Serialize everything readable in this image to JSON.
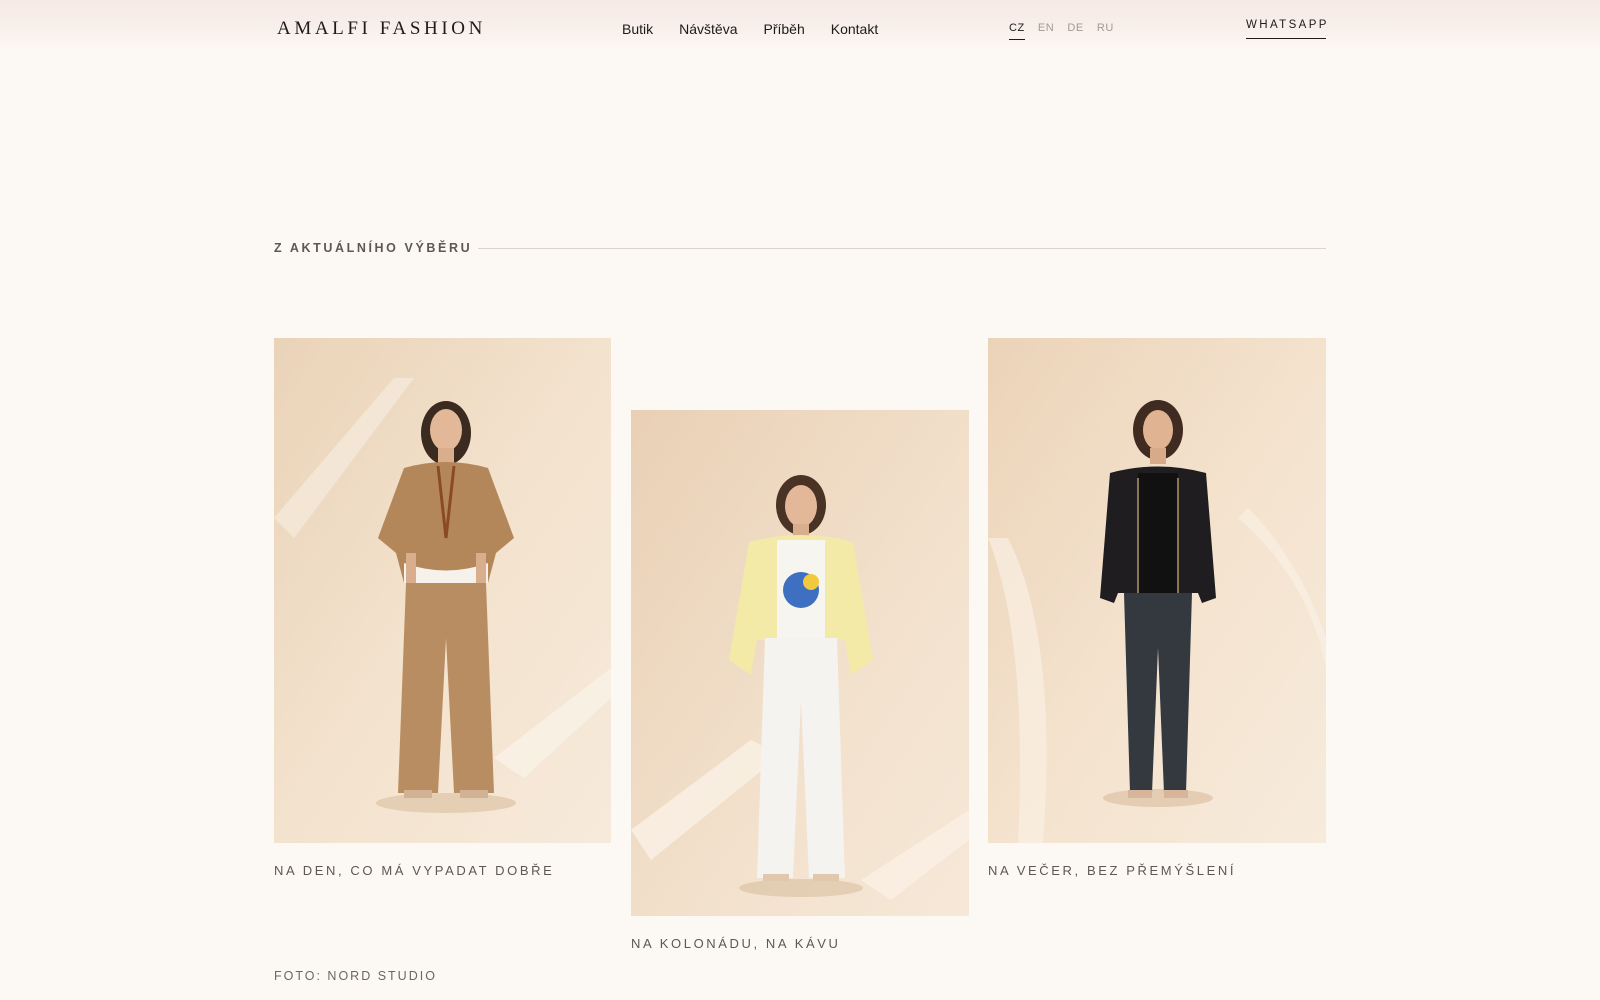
{
  "header": {
    "logo": "AMALFI FASHION",
    "nav": [
      "Butik",
      "Návštěva",
      "Příběh",
      "Kontakt"
    ],
    "languages": [
      "CZ",
      "EN",
      "DE",
      "RU"
    ],
    "active_language": "CZ",
    "whatsapp": "WHATSAPP"
  },
  "section": {
    "title": "Z AKTUÁLNÍHO VÝBĚRU"
  },
  "looks": [
    {
      "caption": "NA DEN, CO MÁ VYPADAT DOBŘE",
      "photo": "woman-beige-ruffle-blouse-wide-trousers"
    },
    {
      "caption": "NA KOLONÁDU, NA KÁVU",
      "photo": "woman-yellow-cardigan-white-trousers"
    },
    {
      "caption": "NA VEČER, BEZ PŘEMÝŠLENÍ",
      "photo": "woman-black-jacket-dark-jeans"
    }
  ],
  "credit": "FOTO: NORD STUDIO",
  "colors": {
    "background": "#fcf8f3",
    "text": "#1f1b18",
    "muted": "#5f5852",
    "photo_backdrop": "#f2ddc4"
  }
}
